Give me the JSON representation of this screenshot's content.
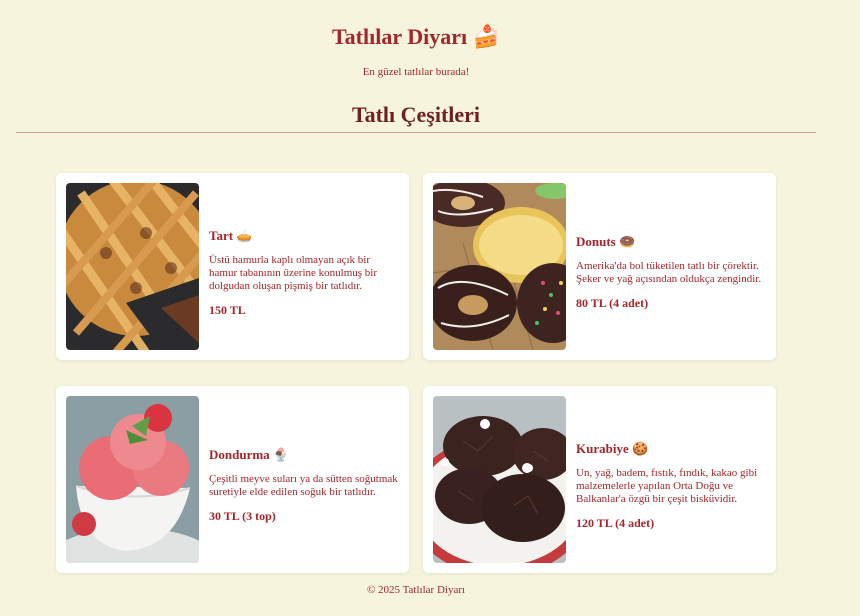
{
  "header": {
    "title": "Tatlılar Diyarı 🍰",
    "tagline": "En güzel tatlılar burada!"
  },
  "section": {
    "title": "Tatlı Çeşitleri"
  },
  "products": [
    {
      "name": "Tart 🥧",
      "description": "Üstü hamurla kaplı olmayan açık bir hamur tabanının üzerine konulmuş bir dolgudan oluşan pişmiş bir tatlıdır.",
      "price": "150 TL"
    },
    {
      "name": "Donuts 🍩",
      "description": "Amerika'da bol tüketilen tatlı bir çörektir. Şeker ve yağ açısından oldukça zengindir.",
      "price": "80 TL (4 adet)"
    },
    {
      "name": "Dondurma 🍨",
      "description": "Çeşitli meyve suları ya da sütten soğutmak suretiyle elde edilen soğuk bir tatlıdır.",
      "price": "30 TL (3 top)"
    },
    {
      "name": "Kurabiye 🍪",
      "description": "Un, yağ, badem, fıstık, fındık, kakao gibi malzemelerle yapılan Orta Doğu ve Balkanlar'a özgü bir çeşit bisküvidir.",
      "price": "120 TL (4 adet)"
    }
  ],
  "footer": {
    "copyright": "© 2025 Tatlılar Diyarı"
  }
}
